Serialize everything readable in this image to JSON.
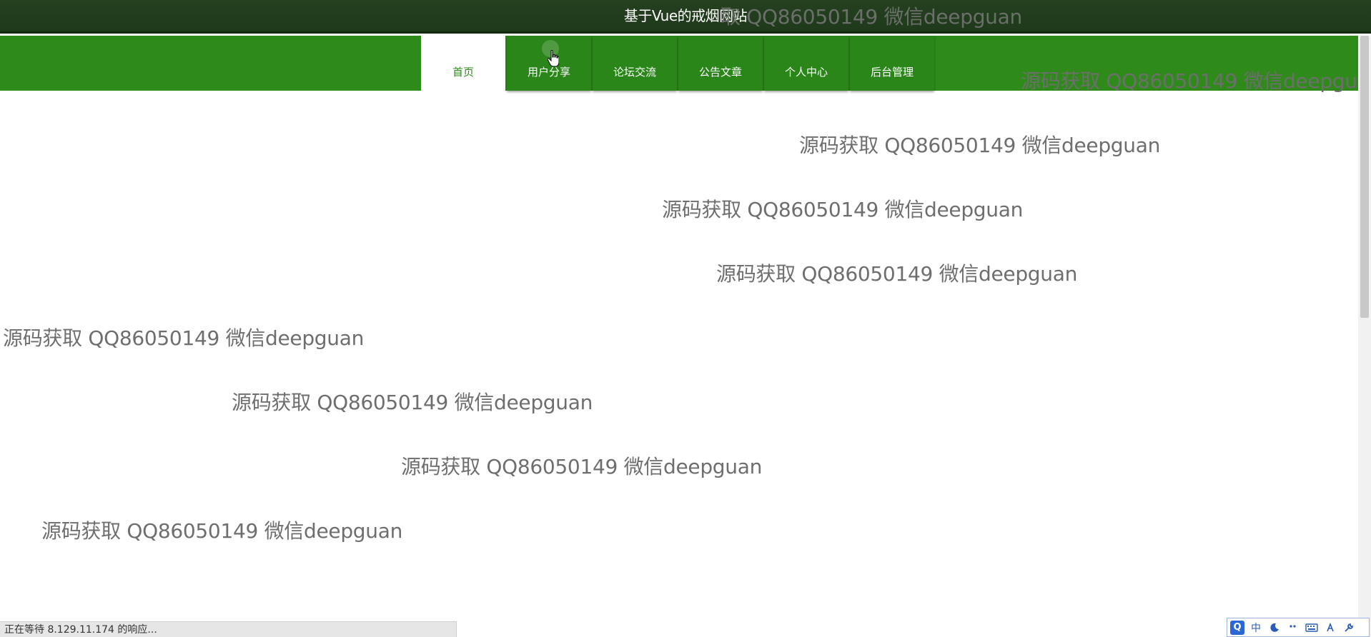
{
  "site": {
    "title": "基于Vue的戒烟网站"
  },
  "nav": {
    "items": [
      {
        "label": "首页",
        "active": true
      },
      {
        "label": "用户分享",
        "active": false
      },
      {
        "label": "论坛交流",
        "active": false
      },
      {
        "label": "公告文章",
        "active": false
      },
      {
        "label": "个人中心",
        "active": false
      },
      {
        "label": "后台管理",
        "active": false
      }
    ]
  },
  "watermark": {
    "text": "源码获取 QQ86050149 微信deepguan",
    "truncated_text_top": "取 QQ86050149 微信deepguan",
    "truncated_text_right": "源码获取 QQ86050149 微信deepgu"
  },
  "statusbar": {
    "text": "正在等待 8.129.11.174 的响应..."
  },
  "ime": {
    "lang_label": "中",
    "items": [
      "ime-logo-icon",
      "moon-icon",
      "punctuation-icon",
      "keyboard-icon",
      "gesture-icon",
      "settings-wrench-icon"
    ]
  },
  "colors": {
    "title_bar": "#1f3a1b",
    "nav_bar": "#2e8b1a",
    "active_tab_text": "#2e8b1a",
    "watermark": "#6e6e6e"
  }
}
